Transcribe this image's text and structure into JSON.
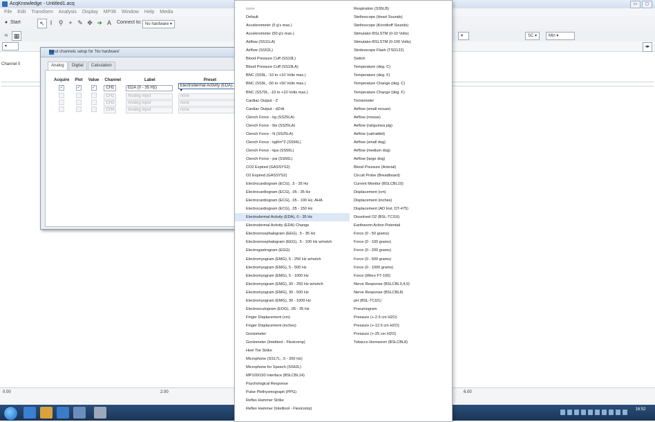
{
  "window": {
    "title": "AcqKnowledge - Untitled1.acq"
  },
  "window_controls": [
    "▭",
    "▢"
  ],
  "menubar": [
    "File",
    "Edit",
    "Transform",
    "Analysis",
    "Display",
    "MP36",
    "Window",
    "Help",
    "Media"
  ],
  "toolbar": {
    "start_label": "Start",
    "connect_label": "Connect to:",
    "connect_value": "No hardware"
  },
  "toolbar2": {
    "sc_label": "SC",
    "min_label": "Min"
  },
  "channel_row": {
    "label": "Channel 0"
  },
  "dialog": {
    "title": "Input channels setup for 'No hardware'",
    "tabs": [
      "Analog",
      "Digital",
      "Calculation"
    ],
    "columns": [
      "Acquire",
      "Plot",
      "Value",
      "Channel",
      "Label",
      "Preset"
    ],
    "rows": [
      {
        "acquire": "✓",
        "plot": "✓",
        "value": "✓",
        "channel": "CH1",
        "label": "EDA (0 - 35 Hz)",
        "preset": "Electrodermal Activity (EDA), ▾"
      },
      {
        "acquire": "",
        "plot": "",
        "value": "",
        "channel": "CH2",
        "label": "Analog input",
        "preset": "none"
      },
      {
        "acquire": "",
        "plot": "",
        "value": "",
        "channel": "CH3",
        "label": "Analog input",
        "preset": "none"
      },
      {
        "acquire": "",
        "plot": "",
        "value": "",
        "channel": "CH4",
        "label": "Analog input",
        "preset": "none"
      }
    ]
  },
  "preset_menu": {
    "checked_item": "Electrodermal Activity (EDA), 0 - 35 Hz",
    "check_glyph": "✓",
    "column1": [
      "none",
      "Default",
      "Accelerometer (5 g's max.)",
      "Accelerometer (50 g's max.)",
      "Airflow (SS11LA)",
      "Airflow (SS52L)",
      "Blood Pressure Cuff (SS19L)",
      "Blood Pressure Cuff (SS19LA)",
      "BNC (SS9L, -10 to +10 Volts max.)",
      "BNC (SS9L, -50 to +50 Volts max.)",
      "BNC (SS70L, -10 to +10 Volts max.)",
      "Cardiac Output - Z",
      "Cardiac Output - dZ/dt",
      "Clench Force - kg (SS25LA)",
      "Clench Force - lbs (SS25LA)",
      "Clench Force - N (SS25LA)",
      "Clench Force - kgf/m^2 (SS56L)",
      "Clench Force - kpa (SS56L)",
      "Clench Force - psi (SS56L)",
      "CO2 Expired (GASSYS2)",
      "O2 Expired (GASSYS2)",
      "Electrocardiogram (ECG), .5 - 35 Hz",
      "Electrocardiogram (ECG), .05 - 35 Hz",
      "Electrocardiogram (ECG), .05 - 100 Hz, AHA",
      "Electrocardiogram (ECG), .05 - 150 Hz",
      "Electrodermal Activity (EDA), 0 - 35 Hz",
      "Electrodermal Activity (EDA) Change",
      "Electroencephalogram (EEG), .5 - 35 Hz",
      "Electroencephalogram (EEG), .5 - 100 Hz w/notch",
      "Electrogastrogram (EGG)",
      "Electromyogram (EMG), 5 - 250 Hz w/notch",
      "Electromyogram (EMG), 5 - 500 Hz",
      "Electromyogram (EMG), 5 - 1000 Hz",
      "Electromyogram (EMG), 30 - 250 Hz w/notch",
      "Electromyogram (EMG), 30 - 500 Hz",
      "Electromyogram (EMG), 30 - 1000 Hz",
      "Electrooculogram (EOG), .05 - 35 Hz",
      "Finger Displacement (cm)",
      "Finger Displacement (inches)",
      "Goniometer",
      "Goniometer (Intelitool - Flexicomp)",
      "Heel Toe Strike",
      "Microphone (SS17L, .5 - 200 Hz)",
      "Microphone for Speech (SS62L)",
      "MP100/150 Interface (BSLCBL14)",
      "Psychological Response",
      "Pulse Plethysmograph (PPG)",
      "Reflex Hammer Strike",
      "Reflex Hammer (Intelitool - Flexicomp)"
    ],
    "column2": [
      "Respiration (SS5LB)",
      "Stethoscope (Heart Sounds)",
      "Stethoscope (Korotkoff Sounds)",
      "Stimulator-BSLSTM (0-10 Volts)",
      "Stimulator-BSLSTM (0-100 Volts)",
      "Stroboscope Flash (TSD122)",
      "Switch",
      "Temperature (deg. C)",
      "Temperature (deg. F)",
      "Temperature Change (deg. C)",
      "Temperature Change (deg. F)",
      "Torsiometer",
      "Airflow (small mouse)",
      "Airflow (mouse)",
      "Airflow (rat/guinea pig)",
      "Airflow (cat/rabbit)",
      "Airflow (small dog)",
      "Airflow (medium dog)",
      "Airflow (large dog)",
      "Blood Pressure (Arterial)",
      "Circuit Probe (Breadboard)",
      "Current Monitor (BSLCBL10)",
      "Displacement (cm)",
      "Displacement (inches)",
      "Displacement (AD Inst. DT-475)",
      "Dissolved O2 (BSL-TCI16)",
      "Earthworm Action Potential",
      "Force (0 - 50 grams)",
      "Force (0 - 100 grams)",
      "Force (0 - 200 grams)",
      "Force (0 - 500 grams)",
      "Force (0 - 1000 grams)",
      "Force (iWorx FT-100)",
      "Nerve Response (BSLCBL3,4,9)",
      "Nerve Response (BSLCBL8)",
      "pH (BSL-TCI21)",
      "Pneumogram",
      "Pressure (+-2.5 cm H2O)",
      "Pressure (+-12.5 cm H2O)",
      "Pressure (+-25 cm H2O)",
      "Tobacco Hornworm (BSLCBL8)"
    ]
  },
  "ruler": {
    "ticks": [
      "0.00",
      "2.00",
      "6.00"
    ]
  },
  "taskbar": {
    "clock_time": "16:52"
  },
  "colors": {
    "accent": "#2f6db5",
    "highlight": "#dde8f6",
    "taskbar": "#1b3556"
  }
}
